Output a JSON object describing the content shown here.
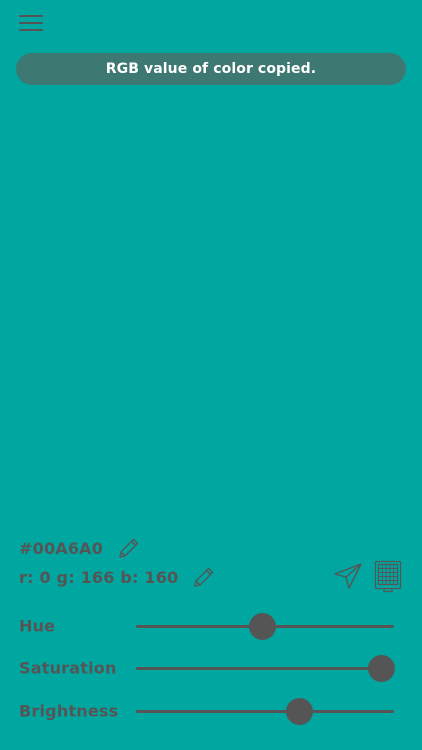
{
  "toast": {
    "message": "RGB value of color copied."
  },
  "color": {
    "hex_text": "#00A6A0",
    "rgb_text": "r: 0 g: 166 b: 160",
    "background": "#00A6A0"
  },
  "icons": {
    "menu": "hamburger-menu-icon",
    "edit": "pencil-icon",
    "share": "paper-plane-icon",
    "calculator": "calculator-icon"
  },
  "sliders": [
    {
      "label": "Hue",
      "value": 0.49
    },
    {
      "label": "Saturation",
      "value": 0.95
    },
    {
      "label": "Brightness",
      "value": 0.635
    }
  ],
  "ui_colors": {
    "foreground": "#555555",
    "toast_bg": "#3E7872",
    "toast_text": "#FFFFFF"
  }
}
